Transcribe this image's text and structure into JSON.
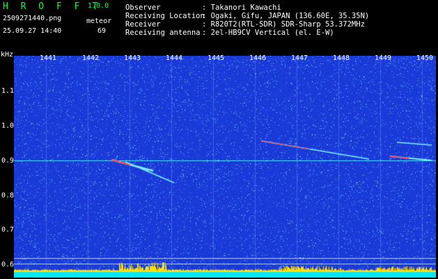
{
  "header": {
    "title": "H R O F F T",
    "version": "1.0.0",
    "filename": "2509271440.png",
    "datetime": "25.09.27 14:40",
    "meteor_label": "meteor",
    "meteor_count": "69"
  },
  "info": [
    {
      "label": "Observer",
      "value": ": Takanori Kawachi"
    },
    {
      "label": "Receiving Location",
      "value": ": Ogaki, Gifu, JAPAN (136.60E, 35.35N)"
    },
    {
      "label": "Receiver",
      "value": ": R820T2(RTL-SDR) SDR-Sharp 53.372MHz"
    },
    {
      "label": "Receiving antenna",
      "value": ": 2el-HB9CV Vertical (el. E-W)"
    }
  ],
  "axis": {
    "unit": "kHz",
    "time_ticks": [
      "1441",
      "1442",
      "1443",
      "1444",
      "1445",
      "1446",
      "1447",
      "1448",
      "1449",
      "1450"
    ],
    "freq_ticks": [
      "1.1",
      "1.0",
      "0.9",
      "0.8",
      "0.7",
      "0.6"
    ]
  },
  "colors": {
    "background": "#1a3ad8",
    "noise": "#5cb0ff",
    "carrier": "#46e6ff",
    "echo_hot": "#ff4040",
    "baseline_yellow": "#ffe000",
    "baseline_cyan": "#00e8ff"
  }
}
